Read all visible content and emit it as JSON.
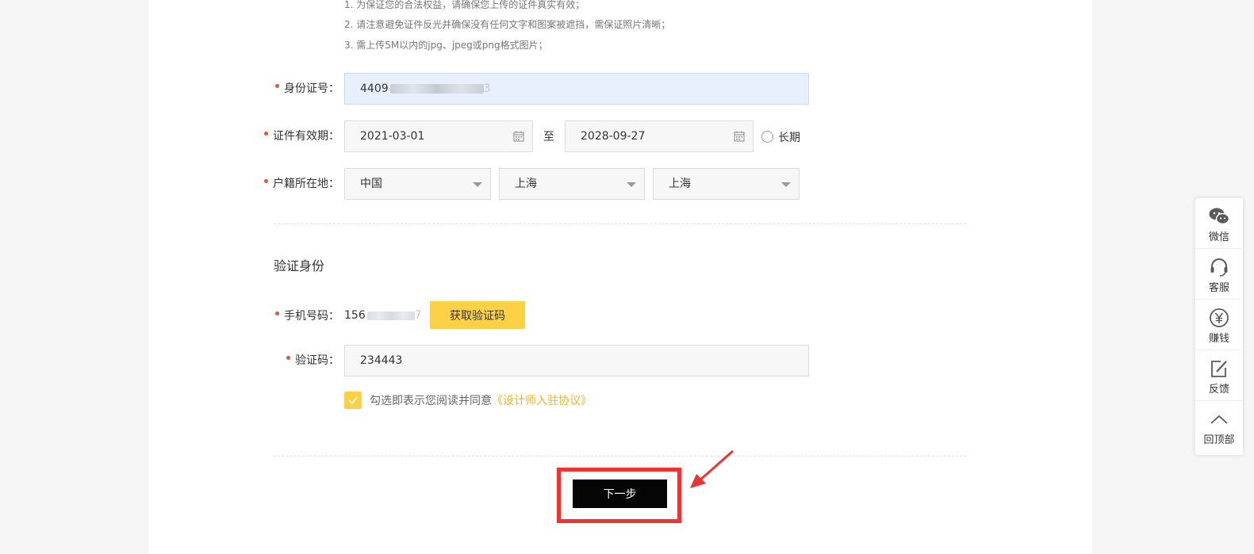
{
  "notes": [
    "1. 为保证您的合法权益，请确保您上传的证件真实有效；",
    "2. 请注意避免证件反光并确保没有任何文字和图案被遮挡，需保证照片清晰；",
    "3. 需上传5M以内的jpg、jpeg或png格式图片；"
  ],
  "id_number": {
    "label": "身份证号：",
    "value_prefix": "4409",
    "value_suffix": "3"
  },
  "validity": {
    "label": "证件有效期：",
    "start": "2021-03-01",
    "separator": "至",
    "end": "2028-09-27",
    "long_term_label": "长期"
  },
  "residence": {
    "label": "户籍所在地：",
    "country": "中国",
    "province": "上海",
    "city": "上海"
  },
  "verify": {
    "section_title": "验证身份",
    "phone_label": "手机号码：",
    "phone_prefix": "156",
    "phone_suffix": "7",
    "get_code_button": "获取验证码",
    "code_label": "验证码：",
    "code_value": "234443",
    "agree_text": "勾选即表示您阅读并同意",
    "agree_link": "《设计师入驻协议》"
  },
  "next_button": "下一步",
  "sidebar": [
    {
      "label": "微信",
      "icon": "wechat-icon"
    },
    {
      "label": "客服",
      "icon": "headset-icon"
    },
    {
      "label": "赚钱",
      "icon": "yen-icon"
    },
    {
      "label": "反馈",
      "icon": "edit-icon"
    },
    {
      "label": "回顶部",
      "icon": "chevron-up-icon"
    }
  ],
  "colors": {
    "accent": "#fdd146",
    "highlight": "#ee3333",
    "required": "#e4572e"
  }
}
